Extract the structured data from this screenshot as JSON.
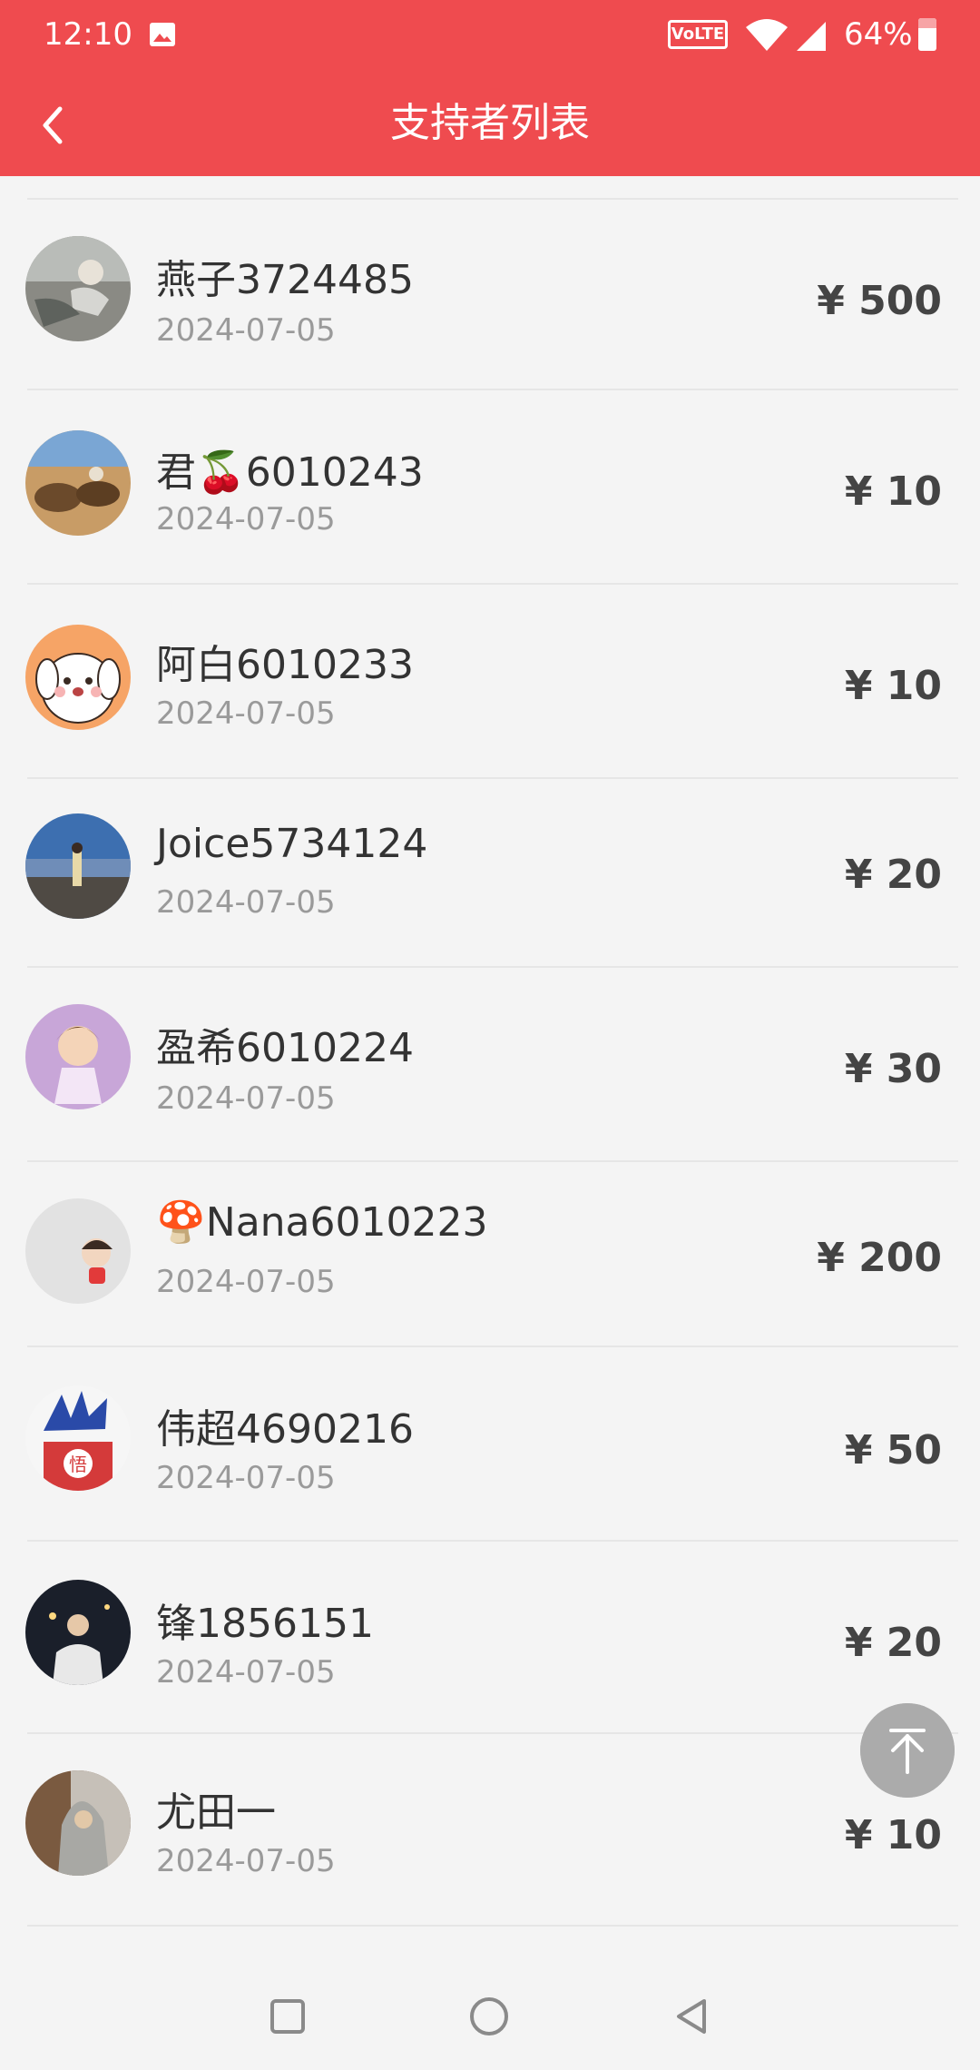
{
  "status_bar": {
    "time": "12:10",
    "volte": "VoLTE",
    "battery": "64%"
  },
  "header": {
    "title": "支持者列表"
  },
  "supporters": [
    {
      "name": "燕子3724485",
      "date": "2024-07-05",
      "amount": "¥ 500"
    },
    {
      "name": "君🍒6010243",
      "date": "2024-07-05",
      "amount": "¥ 10"
    },
    {
      "name": "阿白6010233",
      "date": "2024-07-05",
      "amount": "¥ 10"
    },
    {
      "name": "Joice5734124",
      "date": "2024-07-05",
      "amount": "¥ 20"
    },
    {
      "name": "盈希6010224",
      "date": "2024-07-05",
      "amount": "¥ 30"
    },
    {
      "name": "🍄Nana6010223",
      "date": "2024-07-05",
      "amount": "¥ 200"
    },
    {
      "name": "伟超4690216",
      "date": "2024-07-05",
      "amount": "¥ 50"
    },
    {
      "name": "锋1856151",
      "date": "2024-07-05",
      "amount": "¥ 20"
    },
    {
      "name": "尤田一",
      "date": "2024-07-05",
      "amount": "¥ 10"
    }
  ],
  "icons": {
    "back": "chevron-left-icon",
    "scroll_top": "arrow-up-to-top-icon",
    "nav": [
      "recents-square-icon",
      "home-circle-icon",
      "back-triangle-icon"
    ]
  },
  "colors": {
    "header_bg": "#ef4b4f",
    "page_bg": "#f4f4f4",
    "amount_text": "#444444"
  }
}
